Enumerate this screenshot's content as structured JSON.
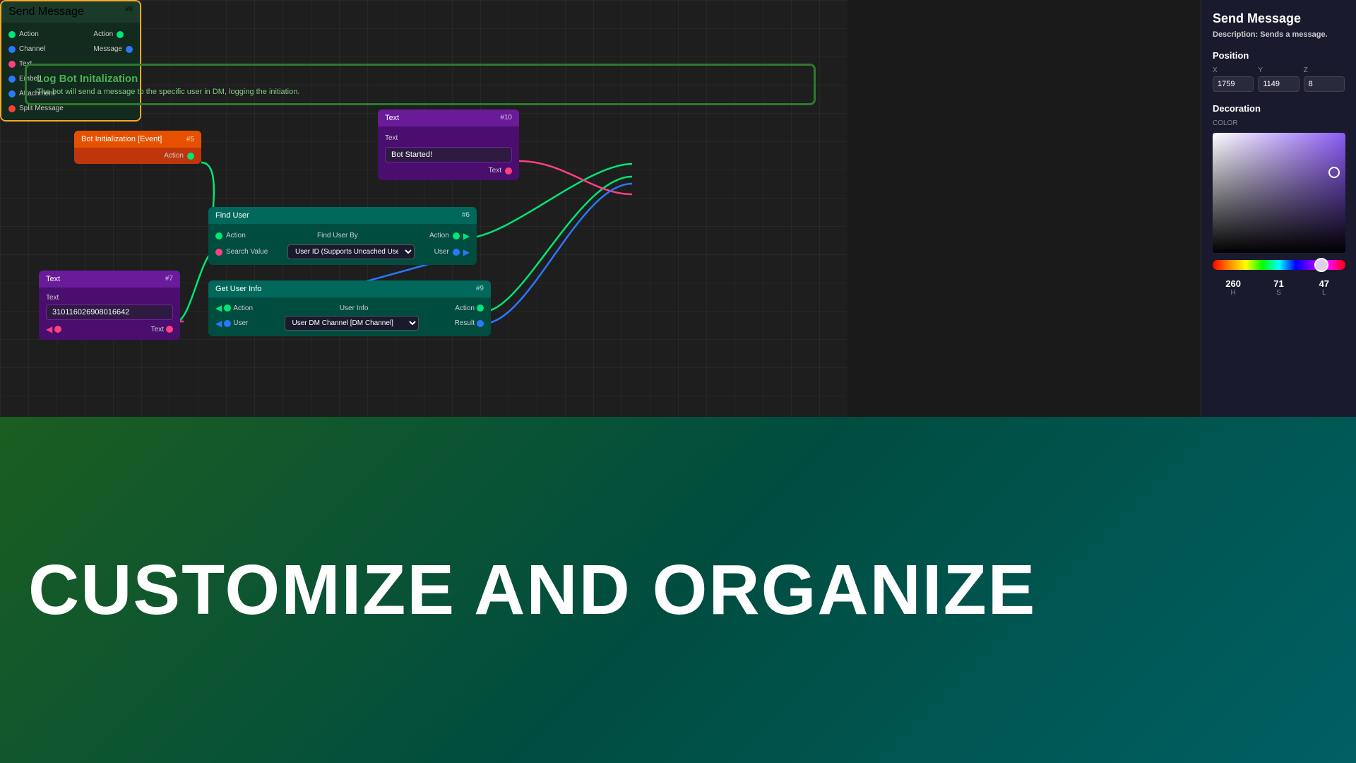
{
  "canvas": {
    "background": "#1e1e1e"
  },
  "logbot": {
    "title": "Log Bot Initalization",
    "description": "The bot will send a message to the specific user in DM, logging the initiation."
  },
  "nodes": {
    "bot_init": {
      "label": "Bot Initialization [Event]",
      "id": "#5",
      "output_label": "Action"
    },
    "text_10": {
      "label": "Text",
      "id": "#10",
      "field_label": "Text",
      "field_value": "Bot Started!",
      "output_label": "Text"
    },
    "send_message": {
      "label": "Send Message",
      "id": "#8",
      "inputs": [
        "Action",
        "Channel",
        "Text",
        "Embed",
        "Attachment",
        "Split Message"
      ],
      "outputs": [
        "Action",
        "Message"
      ]
    },
    "find_user": {
      "label": "Find User",
      "id": "#6",
      "input1": "Action",
      "input2": "Search Value",
      "field1_label": "Find User By",
      "field1_value": "User ID (Supports Uncached User)",
      "output1": "Action",
      "output2": "User"
    },
    "text_7": {
      "label": "Text",
      "id": "#7",
      "field_label": "Text",
      "field_value": "310116026908016642",
      "output_label": "Text"
    },
    "get_user_info": {
      "label": "Get User Info",
      "id": "#9",
      "input1": "Action",
      "input2": "User",
      "field1_label": "User Info",
      "field1_value": "User DM Channel [DM Channel]",
      "output1": "Action",
      "output2": "Result"
    }
  },
  "right_panel": {
    "title": "Send Message",
    "description_label": "Description:",
    "description_value": "Sends a message.",
    "position_section": "Position",
    "x_label": "X",
    "y_label": "Y",
    "z_label": "Z",
    "x_value": "1759",
    "y_value": "1149",
    "z_value": "8",
    "decoration_section": "Decoration",
    "color_label": "COLOR",
    "hsl": {
      "h": "260",
      "s": "71",
      "l": "47",
      "h_label": "H",
      "s_label": "S",
      "l_label": "L"
    }
  },
  "bottom": {
    "text": "CUSTOMIZE AND ORGANIZE"
  }
}
